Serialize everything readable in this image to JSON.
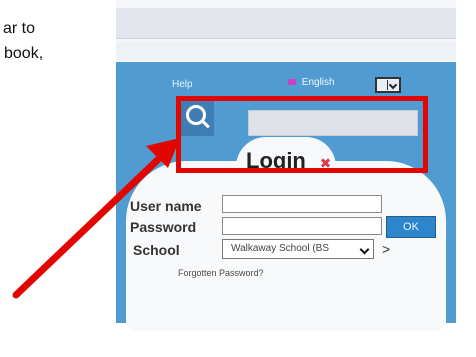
{
  "doc": {
    "line1": "ar to",
    "line2": "book,"
  },
  "app": {
    "help_label": "Help",
    "language_label": "English",
    "login_title": "Login",
    "username_label": "User name",
    "password_label": "Password",
    "school_label": "School",
    "ok_label": "OK",
    "school_value": "Walkaway School (BS",
    "school_next_symbol": ">",
    "forgot_label": "Forgotten Password?"
  },
  "colors": {
    "app_blue": "#4f9bd2",
    "highlight_red": "#e10600"
  },
  "icons": {
    "search": "search-icon",
    "close": "close-icon",
    "chevron": "chevron-down-icon",
    "arrow": "red-arrow-icon"
  }
}
